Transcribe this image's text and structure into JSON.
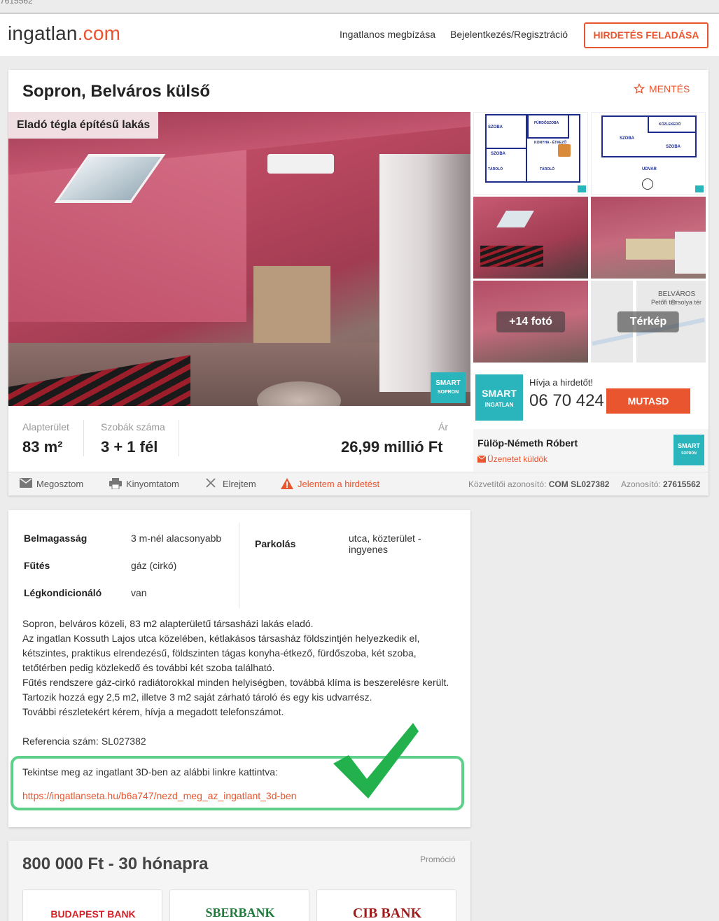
{
  "page_id_fragment": "7615562",
  "header": {
    "logo_main": "ingatlan",
    "logo_tld": ".com",
    "nav": [
      "Ingatlanos megbízása",
      "Bejelentkezés/Regisztráció"
    ],
    "post_button": "HIRDETÉS FELADÁSA",
    "accent_color": "#e8552f"
  },
  "listing": {
    "title": "Sopron, Belváros külső",
    "save_label": "MENTÉS",
    "photo_badge": "Eladó tégla építésű lakás",
    "more_photos": "+14 fotó",
    "map_label": "Térkép",
    "stats": {
      "area_label": "Alapterület",
      "area_value": "83 m²",
      "rooms_label": "Szobák száma",
      "rooms_value": "3 + 1 fél",
      "price_label": "Ár",
      "price_value": "26,99 millió Ft"
    },
    "agent": {
      "cta": "Hívja a hirdetőt!",
      "phone": "06 70 424",
      "show_button": "MUTASD",
      "name": "Fülöp-Németh Róbert",
      "message": "Üzenetet küldök",
      "agency_logo_top": "SMART",
      "agency_logo_bottom": "INGATLAN",
      "agency_logo_city": "SOPRON"
    },
    "actions": {
      "share": "Megosztom",
      "print": "Kinyomtatom",
      "hide": "Elrejtem",
      "report": "Jelentem a hirdetést",
      "broker_id_label": "Közvetítői azonosító:",
      "broker_id": "COM SL027382",
      "id_label": "Azonosító:",
      "id": "27615562"
    }
  },
  "details": {
    "rows_left": [
      {
        "label": "Belmagasság",
        "value": "3 m-nél alacsonyabb"
      },
      {
        "label": "Fűtés",
        "value": "gáz (cirkó)"
      },
      {
        "label": "Légkondicionáló",
        "value": "van"
      }
    ],
    "rows_right": [
      {
        "label": "Parkolás",
        "value": "utca, közterület - ingyenes"
      }
    ],
    "description": [
      "Sopron, belváros közeli, 83 m2 alapterületű társasházi lakás eladó.",
      "Az ingatlan Kossuth Lajos utca közelében, kétlakásos társasház földszintjén helyezkedik el,",
      "kétszintes, praktikus elrendezésű, földszinten tágas konyha-étkező, fürdőszoba, két szoba,",
      "tetőtérben pedig közlekedő és további két szoba található.",
      "Fűtés rendszere gáz-cirkó radiátorokkal minden helyiségben, továbbá klíma is beszerelésre került.",
      "Tartozik hozzá egy 2,5 m2, illetve 3 m2 saját zárható tároló és egy kis udvarrész.",
      "További részletekért kérem, hívja a megadott telefonszámot.",
      "",
      "Referencia szám: SL027382"
    ],
    "link_intro": "Tekintse meg az ingatlant 3D-ben az alábbi linkre kattintva:",
    "link_url": "https://ingatlanseta.hu/b6a747/nezd_meg_az_ingatlant_3d-ben",
    "highlight_color": "#5ed08a"
  },
  "promo": {
    "title": "800 000 Ft - 30 hónapra",
    "tag": "Promóció",
    "banks": [
      "BUDAPEST BANK",
      "SBERBANK",
      "CIB BANK"
    ]
  },
  "floorplan_labels": [
    "SZOBA",
    "FÜRDŐSZOBA",
    "KONYHA - ÉTKEZŐ",
    "SZOBA",
    "TÁROLÓ",
    "TÁROLÓ",
    "KÖZLEKEDŐ",
    "SZOBA",
    "SZOBA",
    "UDVAR"
  ],
  "map_labels": [
    "BELVÁROS",
    "Petőfi tér",
    "Orsolya tér"
  ]
}
